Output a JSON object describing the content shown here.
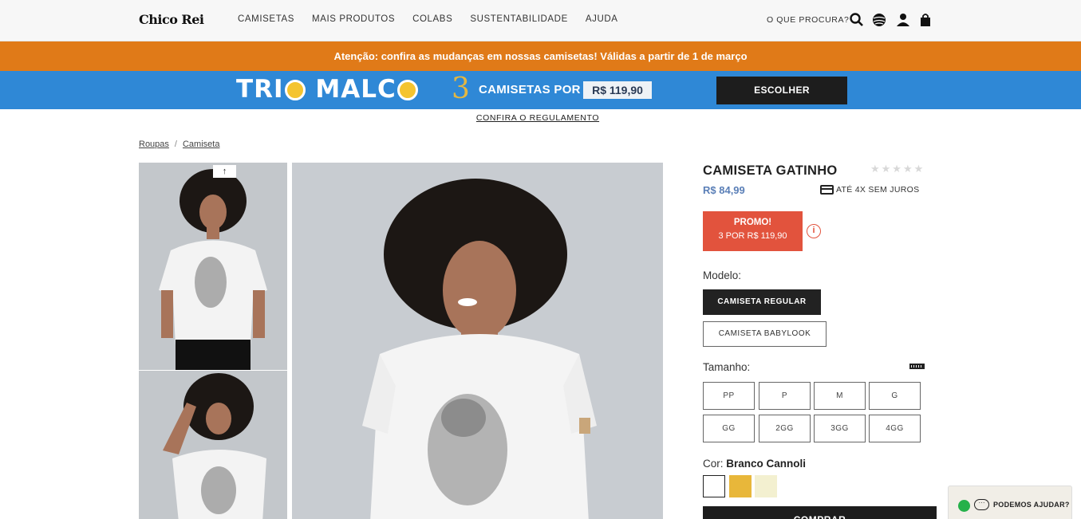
{
  "header": {
    "logo": "Chico Rei",
    "nav": [
      "CAMISETAS",
      "MAIS PRODUTOS",
      "COLABS",
      "SUSTENTABILIDADE",
      "AJUDA"
    ],
    "search_label": "O QUE PROCURA?",
    "icons": [
      "search-icon",
      "globe-icon",
      "user-icon",
      "bag-icon"
    ]
  },
  "notice": "Atenção: confira as mudanças em nossas camisetas! Válidas a partir de 1 de março",
  "banner": {
    "title_part1": "TRI",
    "title_part2": " MAL",
    "title_part3": "C",
    "number": "3",
    "offer_text": "CAMISETAS POR",
    "offer_price": "R$ 119,90",
    "cta": "ESCOLHER",
    "rules_link": "CONFIRA O REGULAMENTO"
  },
  "breadcrumb": [
    "Roupas",
    "Camiseta"
  ],
  "gallery": {
    "up_arrow": "↑"
  },
  "product": {
    "title": "CAMISETA GATINHO",
    "rating_stars": "★★★★★",
    "rating_value": 0,
    "price": "R$ 84,99",
    "installments": "ATÉ 4X SEM JUROS",
    "promo_title": "PROMO!",
    "promo_text": "3 POR R$ 119,90",
    "model_label": "Modelo:",
    "models": [
      "CAMISETA REGULAR",
      "CAMISETA BABYLOOK"
    ],
    "selected_model": "CAMISETA REGULAR",
    "size_label": "Tamanho:",
    "sizes": [
      "PP",
      "P",
      "M",
      "G",
      "GG",
      "2GG",
      "3GG",
      "4GG"
    ],
    "color_label": "Cor:",
    "color_value": "Branco Cannoli",
    "colors": [
      "#ffffff",
      "#e8b73a",
      "#f3f0d0"
    ],
    "buy_label": "COMPRAR"
  },
  "help": {
    "label": "PODEMOS AJUDAR?"
  },
  "colors": {
    "accent_orange": "#e07a18",
    "banner_blue": "#2f88d6",
    "promo_red": "#e2533d",
    "price_blue": "#5a7fb7"
  }
}
